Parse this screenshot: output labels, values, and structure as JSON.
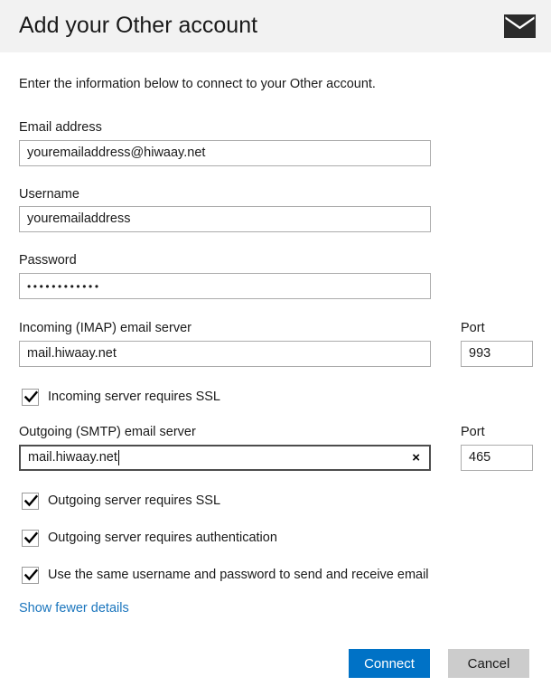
{
  "header": {
    "title": "Add your Other account",
    "icon": "envelope-icon",
    "background_color": "#f2f2f2"
  },
  "intro": "Enter the information below to connect to your Other account.",
  "fields": [
    {
      "label": "Email address",
      "value": "youremailaddress@hiwaay.net",
      "focused": false
    },
    {
      "label": "Username",
      "value": "youremailaddress",
      "focused": false
    },
    {
      "label": "Password",
      "value": "••••••••••••",
      "focused": false
    },
    {
      "label": "Incoming (IMAP) email server",
      "value": "mail.hiwaay.net",
      "focused": false
    },
    {
      "label": "Outgoing (SMTP) email server",
      "value": "mail.hiwaay.net",
      "focused": true,
      "clear_icon": "×"
    }
  ],
  "ports": [
    {
      "label": "Port",
      "value": "993"
    },
    {
      "label": "Port",
      "value": "465"
    }
  ],
  "checkboxes": [
    {
      "label": "Incoming server requires SSL",
      "checked": true
    },
    {
      "label": "Outgoing server requires SSL",
      "checked": true
    },
    {
      "label": "Outgoing server requires authentication",
      "checked": true
    },
    {
      "label": "Use the same username and password to send and receive email",
      "checked": true
    }
  ],
  "details_link": "Show fewer details",
  "buttons": {
    "connect": "Connect",
    "cancel": "Cancel",
    "connect_color": "#0072c6",
    "cancel_color": "#cccccc"
  },
  "colors": {
    "link": "#1a75bd",
    "field_border": "#ababab",
    "field_border_focused": "#4d4d4d"
  }
}
